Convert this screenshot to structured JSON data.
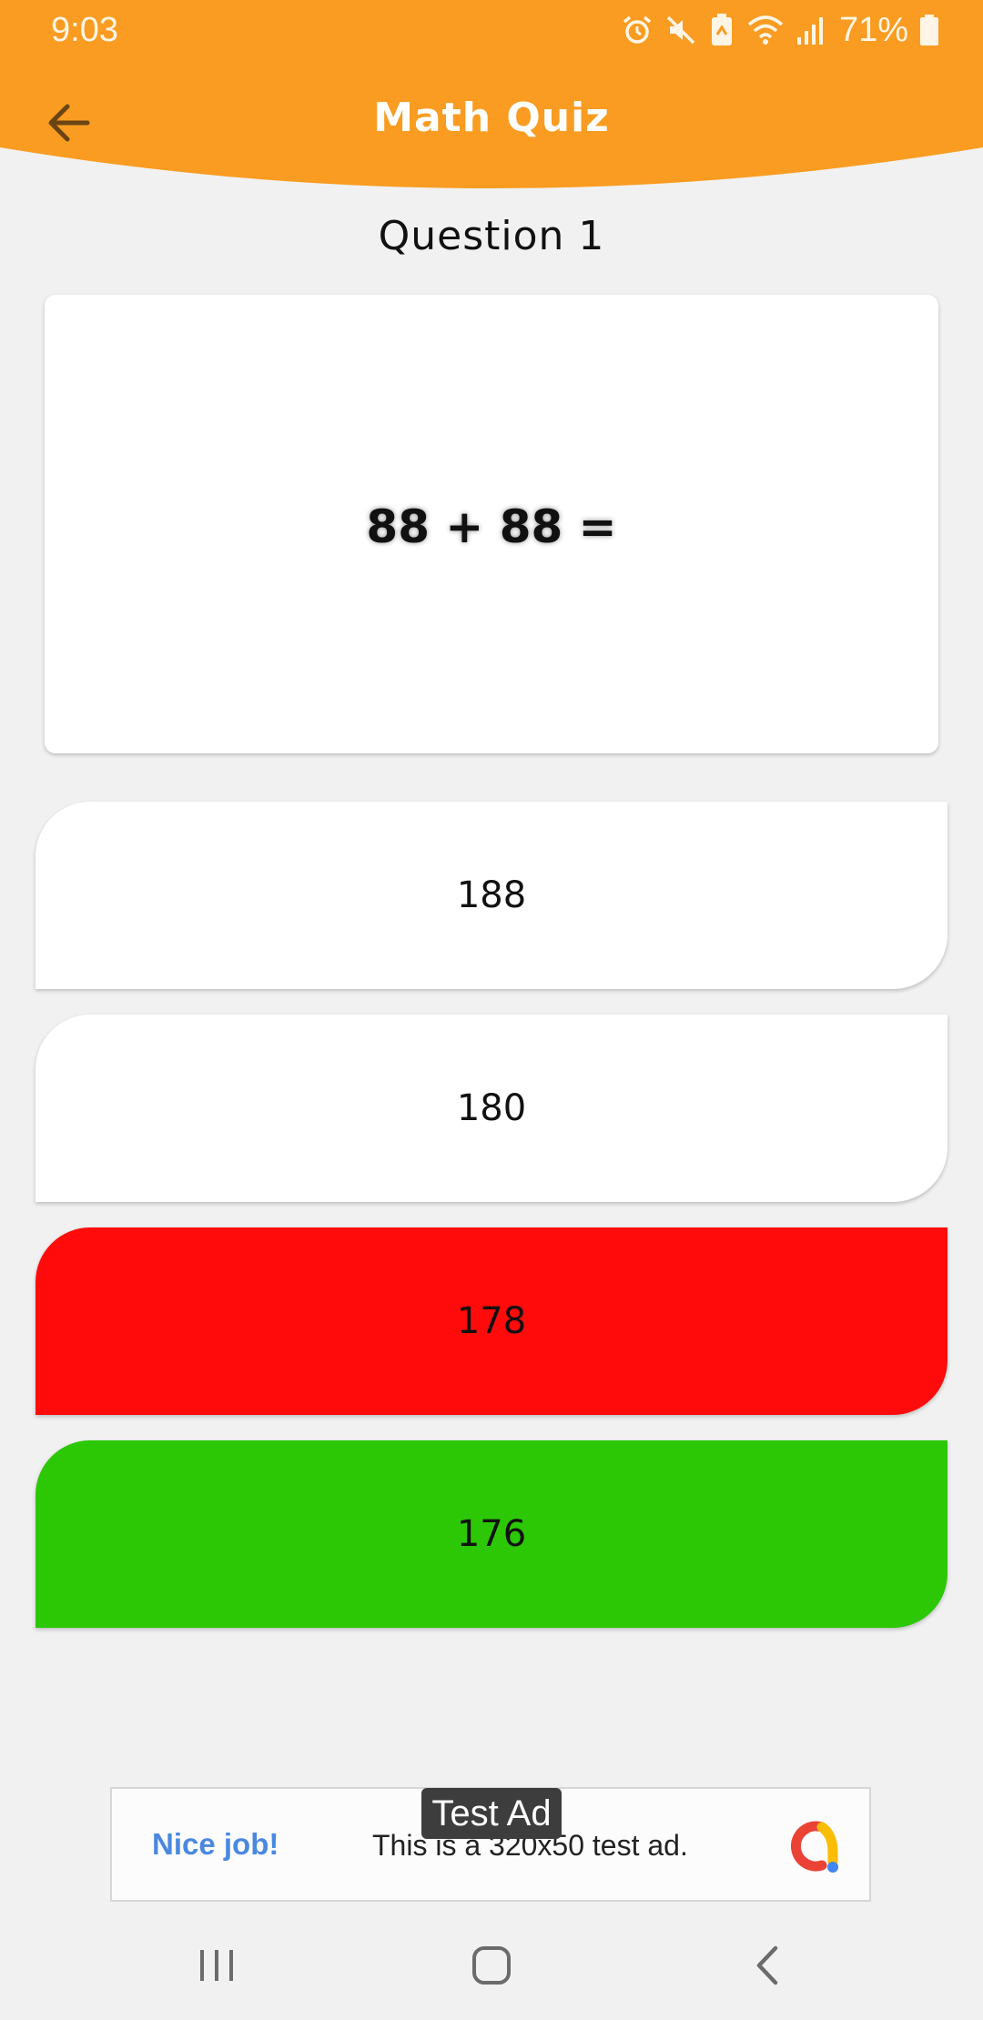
{
  "status_bar": {
    "time": "9:03",
    "battery": "71%"
  },
  "header": {
    "title": "Math Quiz",
    "back_icon": "arrow-back-icon",
    "color": "#f99c21"
  },
  "question": {
    "heading": "Question 1",
    "expression": "88 + 88 ="
  },
  "answers": [
    {
      "label": "188",
      "state": "default",
      "color": "#ffffff"
    },
    {
      "label": "180",
      "state": "default",
      "color": "#ffffff"
    },
    {
      "label": "178",
      "state": "wrong",
      "color": "#ff0b0b"
    },
    {
      "label": "176",
      "state": "correct",
      "color": "#2cc805"
    }
  ],
  "ad": {
    "label": "Test Ad",
    "cta": "Nice job!",
    "text": "This is a 320x50 test ad.",
    "cta_color": "#4a88e0"
  },
  "nav": {
    "icons": [
      "recent-apps-icon",
      "home-icon",
      "back-icon"
    ]
  }
}
